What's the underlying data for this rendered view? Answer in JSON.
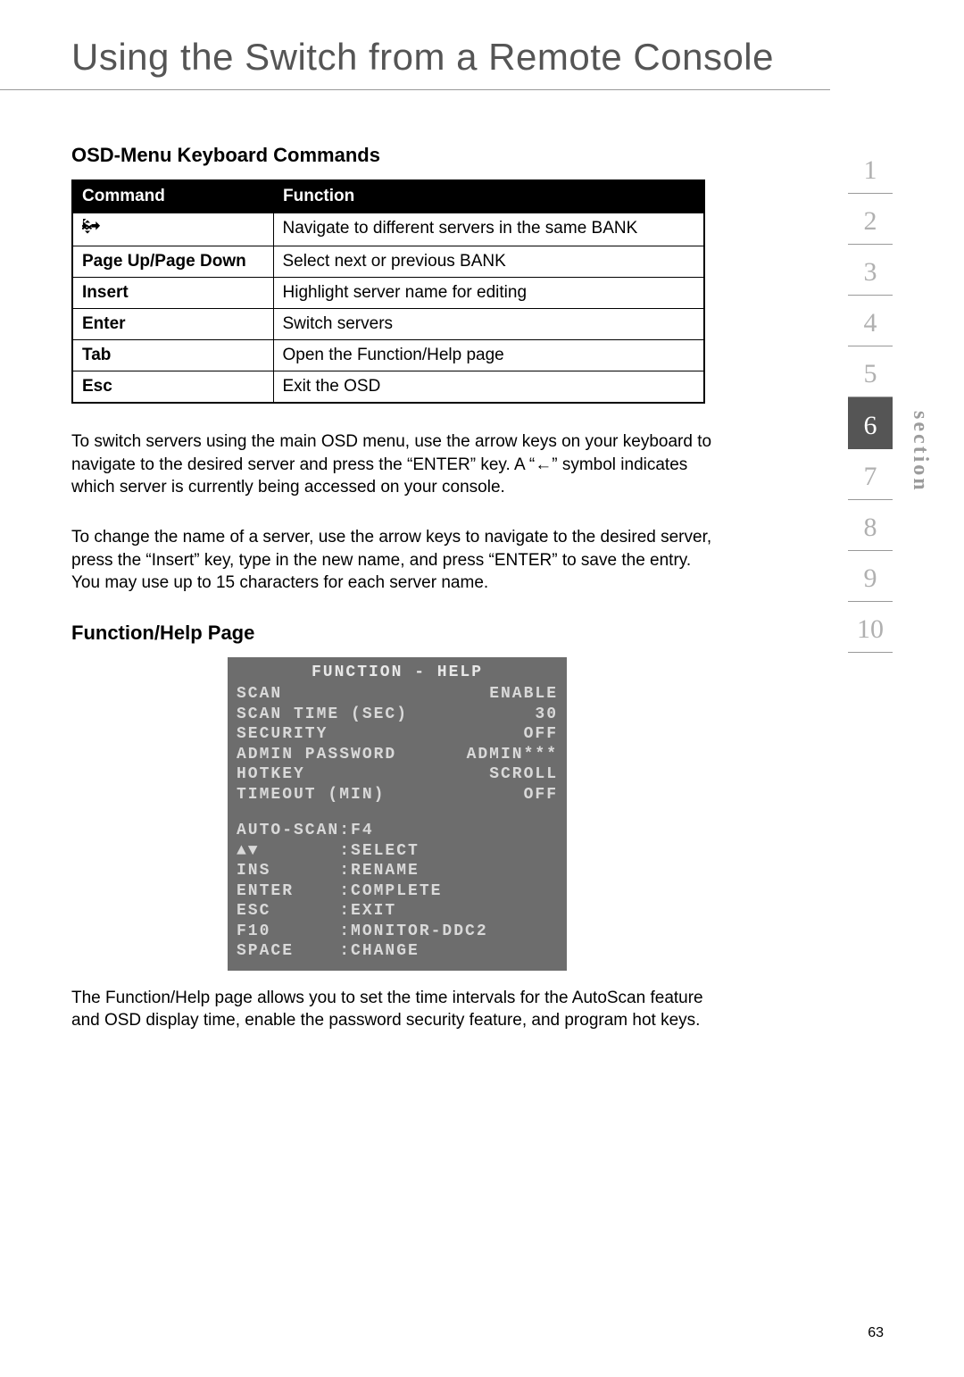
{
  "title": "Using the Switch from a Remote Console",
  "subhead1": "OSD-Menu Keyboard Commands",
  "table": {
    "headers": {
      "command": "Command",
      "function": "Function"
    },
    "rows": [
      {
        "cmd_icon": "arrows-icon",
        "fn": "Navigate to different servers in the same BANK"
      },
      {
        "cmd": "Page Up/Page Down",
        "fn": "Select next or previous BANK"
      },
      {
        "cmd": "Insert",
        "fn": "Highlight server name for editing"
      },
      {
        "cmd": "Enter",
        "fn": "Switch servers"
      },
      {
        "cmd": "Tab",
        "fn": "Open the Function/Help page"
      },
      {
        "cmd": "Esc",
        "fn": "Exit the OSD"
      }
    ]
  },
  "para1": "To switch servers using the main OSD menu, use the arrow keys on your keyboard to navigate to the desired server and press the “ENTER” key. A “←” symbol indicates which server is currently being accessed on your console.",
  "para2": "To change the name of a server, use the arrow keys to navigate to the desired server, press the “Insert” key, type in the new name, and press “ENTER” to save the entry. You may use up to 15 characters for each server name.",
  "subhead2": "Function/Help Page",
  "osd": {
    "title": "FUNCTION - HELP",
    "rows": [
      {
        "l": "SCAN",
        "r": "ENABLE"
      },
      {
        "l": "SCAN TIME (SEC)",
        "r": "30"
      },
      {
        "l": "SECURITY",
        "r": "OFF"
      },
      {
        "l": "ADMIN PASSWORD",
        "r": "ADMIN***"
      },
      {
        "l": "HOTKEY",
        "r": "SCROLL"
      },
      {
        "l": "TIMEOUT (MIN)",
        "r": "OFF"
      }
    ],
    "help": [
      "AUTO-SCAN:F4",
      "▲▼       :SELECT",
      "INS      :RENAME",
      "ENTER    :COMPLETE",
      "ESC      :EXIT",
      "F10      :MONITOR-DDC2",
      "SPACE    :CHANGE"
    ]
  },
  "para3": "The Function/Help page allows you to set the time intervals for the AutoScan feature and OSD display time, enable the password security feature, and program hot keys.",
  "section": {
    "label": "section",
    "items": [
      "1",
      "2",
      "3",
      "4",
      "5",
      "6",
      "7",
      "8",
      "9",
      "10"
    ],
    "active": "6"
  },
  "page_number": "63"
}
